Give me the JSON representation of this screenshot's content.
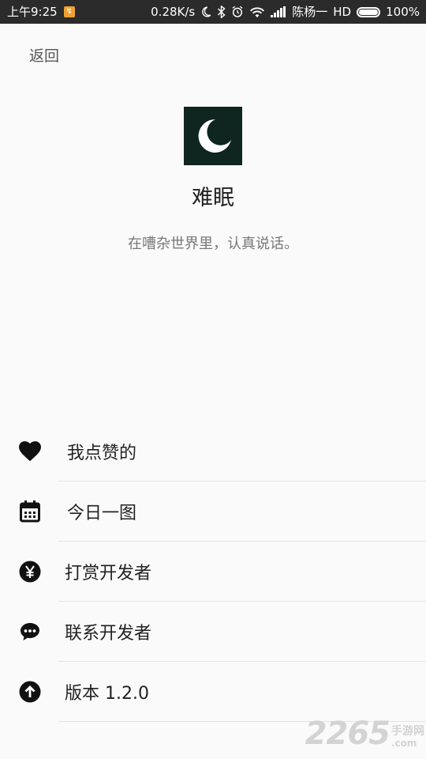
{
  "status_bar": {
    "time": "上午9:25",
    "network_speed": "0.28K/s",
    "carrier": "陈杨一",
    "hd": "HD",
    "battery_text": "100%",
    "battery_level": 1.0
  },
  "nav": {
    "back_label": "返回"
  },
  "header": {
    "app_name": "难眠",
    "tagline": "在嘈杂世界里，认真说话。",
    "logo_icon": "moon-icon",
    "logo_color": "#0f2520"
  },
  "menu": {
    "items": [
      {
        "label": "我点赞的",
        "icon": "heart-icon"
      },
      {
        "label": "今日一图",
        "icon": "calendar-icon"
      },
      {
        "label": "打赏开发者",
        "icon": "yen-icon"
      },
      {
        "label": "联系开发者",
        "icon": "chat-icon"
      },
      {
        "label": "版本 1.2.0",
        "icon": "arrow-up-icon"
      }
    ]
  },
  "watermark": {
    "number": "2265",
    "suffix_top": "手游网",
    "suffix_bottom": ".com"
  }
}
